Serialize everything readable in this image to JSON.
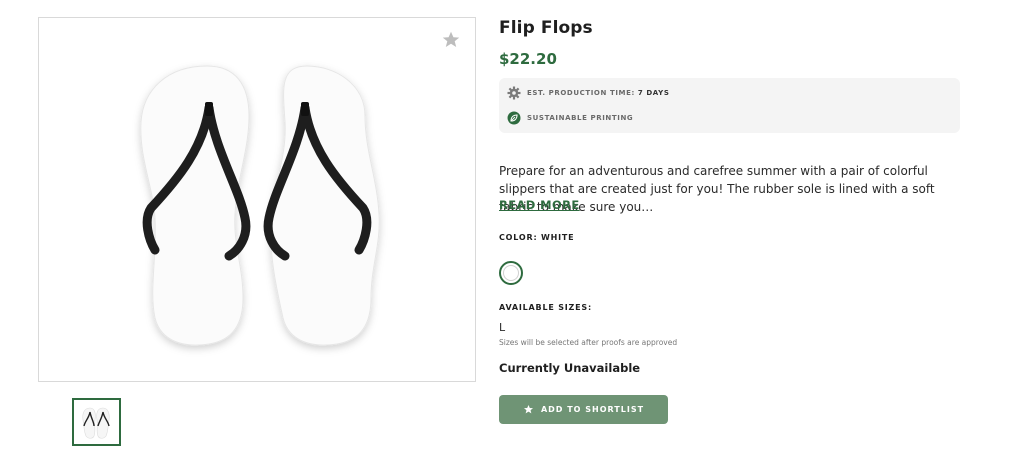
{
  "product": {
    "title": "Flip Flops",
    "price": "$22.20",
    "image_alt": "White flip flops with black straps"
  },
  "meta": {
    "production_label": "EST. PRODUCTION TIME:",
    "production_value": "7 DAYS",
    "sustainable_label": "SUSTAINABLE PRINTING",
    "icons": [
      "gear-icon",
      "leaf-icon"
    ]
  },
  "description": {
    "text": "Prepare for an adventurous and carefree summer with a pair of colorful slippers that are created just for you! The rubber sole is lined with a soft fabric to make sure you…",
    "read_more": "READ MORE"
  },
  "color": {
    "label": "COLOR: WHITE",
    "selected": "#ffffff"
  },
  "sizes": {
    "label": "AVAILABLE SIZES:",
    "value": "L",
    "note": "Sizes will be selected after proofs are approved"
  },
  "availability": "Currently Unavailable",
  "actions": {
    "shortlist_label": "ADD TO SHORTLIST"
  },
  "colors": {
    "accent": "#2e6b3f",
    "button": "#6f9475",
    "meta_bg": "#f4f4f4"
  }
}
